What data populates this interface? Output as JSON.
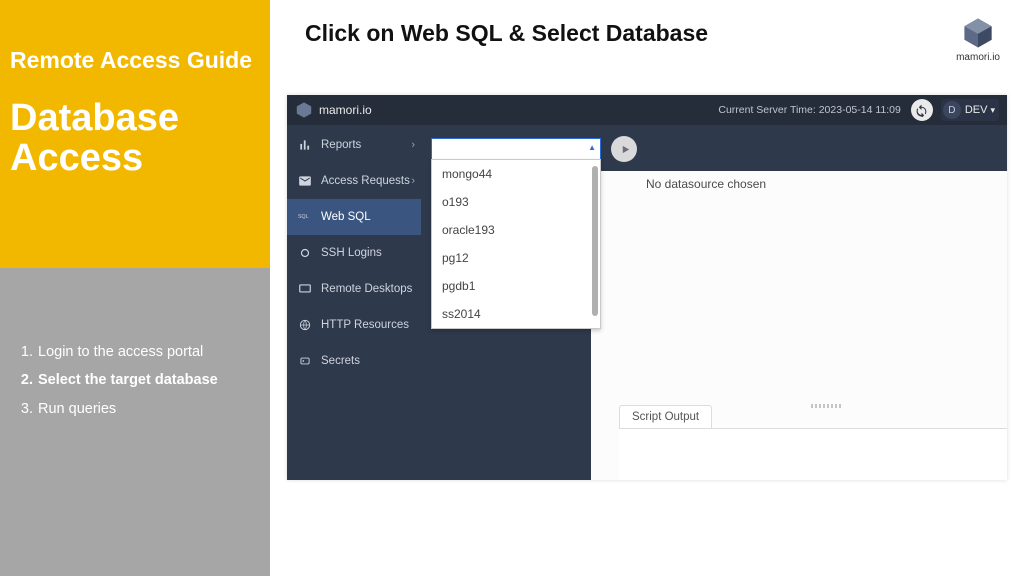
{
  "guide": {
    "subtitle": "Remote Access Guide",
    "title": "Database Access",
    "steps": [
      {
        "label": "Login to the access portal",
        "active": false
      },
      {
        "label": "Select the target database",
        "active": true
      },
      {
        "label": "Run queries",
        "active": false
      }
    ]
  },
  "page": {
    "heading": "Click on Web SQL & Select Database"
  },
  "brand": {
    "name": "mamori.io"
  },
  "app": {
    "header": {
      "product": "mamori.io",
      "server_time_label": "Current Server Time: 2023-05-14 11:09",
      "user_initial": "D",
      "user_name": "DEV"
    },
    "nav": [
      {
        "id": "reports",
        "label": "Reports",
        "has_children": true
      },
      {
        "id": "access-requests",
        "label": "Access Requests",
        "has_children": true
      },
      {
        "id": "web-sql",
        "label": "Web SQL",
        "active": true
      },
      {
        "id": "ssh-logins",
        "label": "SSH Logins"
      },
      {
        "id": "remote-desktops",
        "label": "Remote Desktops"
      },
      {
        "id": "http-resources",
        "label": "HTTP Resources"
      },
      {
        "id": "secrets",
        "label": "Secrets"
      }
    ],
    "stage": {
      "no_datasource": "No datasource chosen",
      "output_tab": "Script Output"
    },
    "db_options": [
      "mongo44",
      "o193",
      "oracle193",
      "pg12",
      "pgdb1",
      "ss2014"
    ]
  }
}
